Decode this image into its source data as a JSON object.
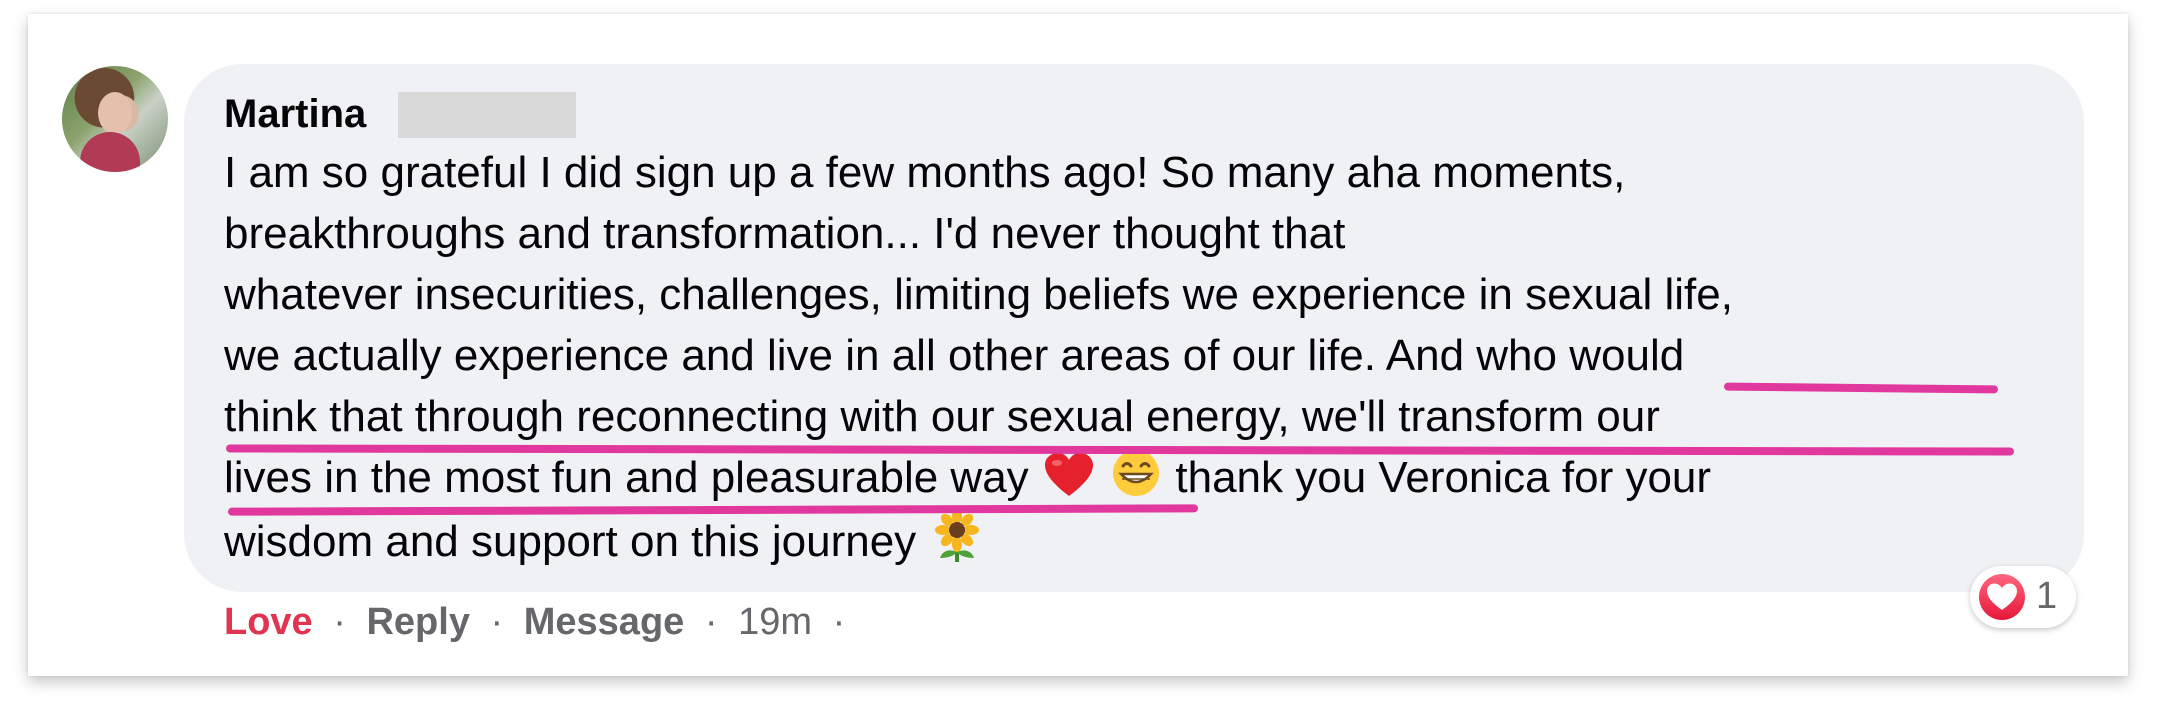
{
  "comment": {
    "author": "Martina",
    "lines": [
      "I am so grateful I did sign up a few months ago! So many aha moments,",
      "breakthroughs and transformation... I'd never thought that",
      "whatever insecurities, challenges, limiting beliefs we experience in sexual life,",
      "we actually experience and live in all other areas of our life. And who would",
      "think that through reconnecting with our sexual energy, we'll transform our",
      "lives in the most fun and pleasurable way",
      "thank you Veronica for your",
      "wisdom and support on this journey"
    ],
    "emojis": {
      "heart": "red-heart-emoji",
      "grin": "grinning-face-emoji",
      "flower": "sunflower-emoji"
    }
  },
  "actions": {
    "love": "Love",
    "reply": "Reply",
    "message": "Message",
    "time": "19m",
    "separator": "·"
  },
  "reaction": {
    "icon": "heart-reaction-icon",
    "count": "1"
  },
  "colors": {
    "bubble": "#f0f1f5",
    "highlight": "#e0389c",
    "love": "#e0344f",
    "muted": "#65676b"
  }
}
